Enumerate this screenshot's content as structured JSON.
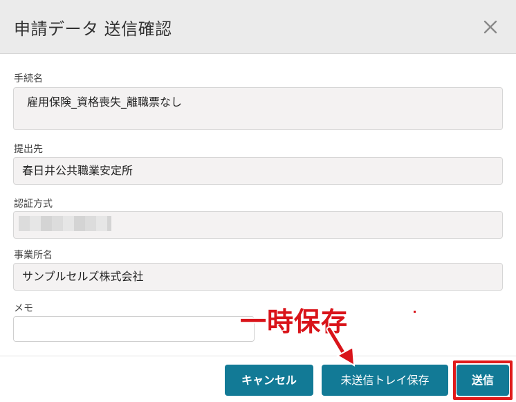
{
  "dialog": {
    "title": "申請データ 送信確認"
  },
  "fields": {
    "procedure": {
      "label": "手続名",
      "value": "雇用保険_資格喪失_離職票なし"
    },
    "submit_to": {
      "label": "提出先",
      "value": "春日井公共職業安定所"
    },
    "auth_method": {
      "label": "認証方式",
      "value": ""
    },
    "office": {
      "label": "事業所名",
      "value": "サンプルセルズ株式会社"
    },
    "memo": {
      "label": "メモ",
      "value": "",
      "placeholder": ""
    }
  },
  "buttons": {
    "cancel": "キャンセル",
    "save_tray": "未送信トレイ保存",
    "send": "送信"
  },
  "annotation": {
    "text": "一時保存",
    "color": "#d9141a"
  },
  "colors": {
    "button": "#127a96",
    "header": "#ebebeb",
    "field_bg": "#f4f2f2",
    "highlight": "#e01b1b"
  }
}
